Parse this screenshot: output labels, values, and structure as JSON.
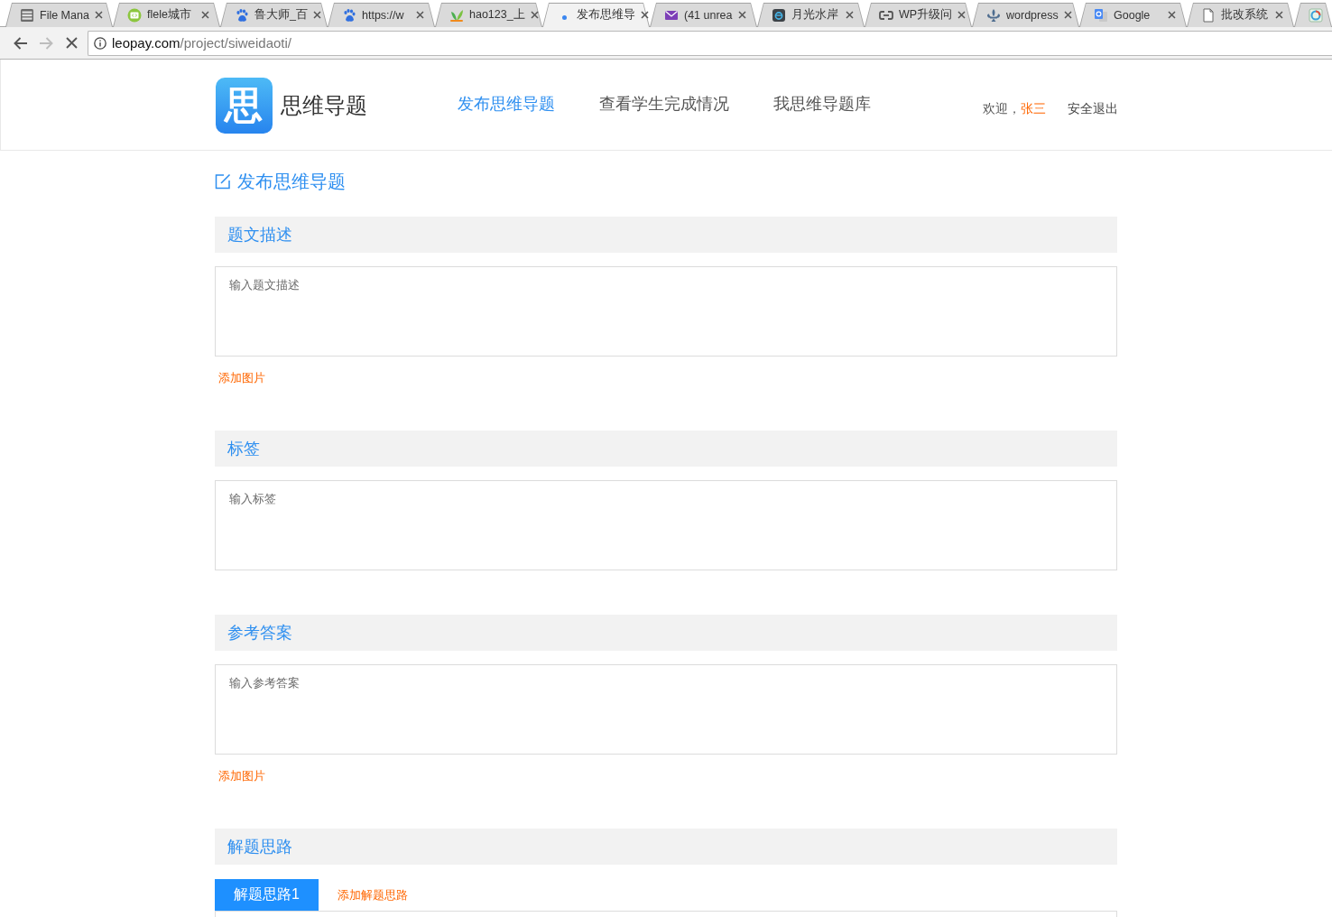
{
  "browser": {
    "tabs": [
      {
        "label": "File Mana",
        "selected": false
      },
      {
        "label": "flele城市",
        "selected": false
      },
      {
        "label": "鲁大师_百",
        "selected": false
      },
      {
        "label": "https://w",
        "selected": false
      },
      {
        "label": "hao123_上",
        "selected": false
      },
      {
        "label": "发布思维导",
        "selected": true
      },
      {
        "label": "(41 unrea",
        "selected": false
      },
      {
        "label": "月光水岸",
        "selected": false
      },
      {
        "label": "WP升级问",
        "selected": false
      },
      {
        "label": "wordpress",
        "selected": false
      },
      {
        "label": "Google",
        "selected": false
      },
      {
        "label": "批改系统",
        "selected": false
      },
      {
        "selected": false
      }
    ],
    "navigation": {
      "forward_disabled": true,
      "loading": true
    },
    "address": {
      "host": "leopay.com",
      "path": "/project/siweidaoti/"
    }
  },
  "header": {
    "logo": {
      "mark": "思",
      "name": "思维导题"
    },
    "nav": [
      {
        "label": "发布思维导题",
        "selected": true
      },
      {
        "label": "查看学生完成情况",
        "selected": false
      },
      {
        "label": "我思维导题库",
        "selected": false
      }
    ],
    "greeting": "欢迎，",
    "user": "张三",
    "logout": "安全退出"
  },
  "page_title": "发布思维导题",
  "sections": [
    {
      "kind": "field",
      "title": "题文描述",
      "placeholder": "输入题文描述",
      "link": "添加图片"
    },
    {
      "kind": "field",
      "title": "标签",
      "placeholder": "输入标签"
    },
    {
      "kind": "field",
      "title": "参考答案",
      "placeholder": "输入参考答案",
      "link": "添加图片"
    },
    {
      "kind": "tabs",
      "title": "解题思路",
      "tabs": [
        {
          "label": "解题思路1",
          "selected": true
        }
      ],
      "link": "添加解题思路"
    }
  ]
}
